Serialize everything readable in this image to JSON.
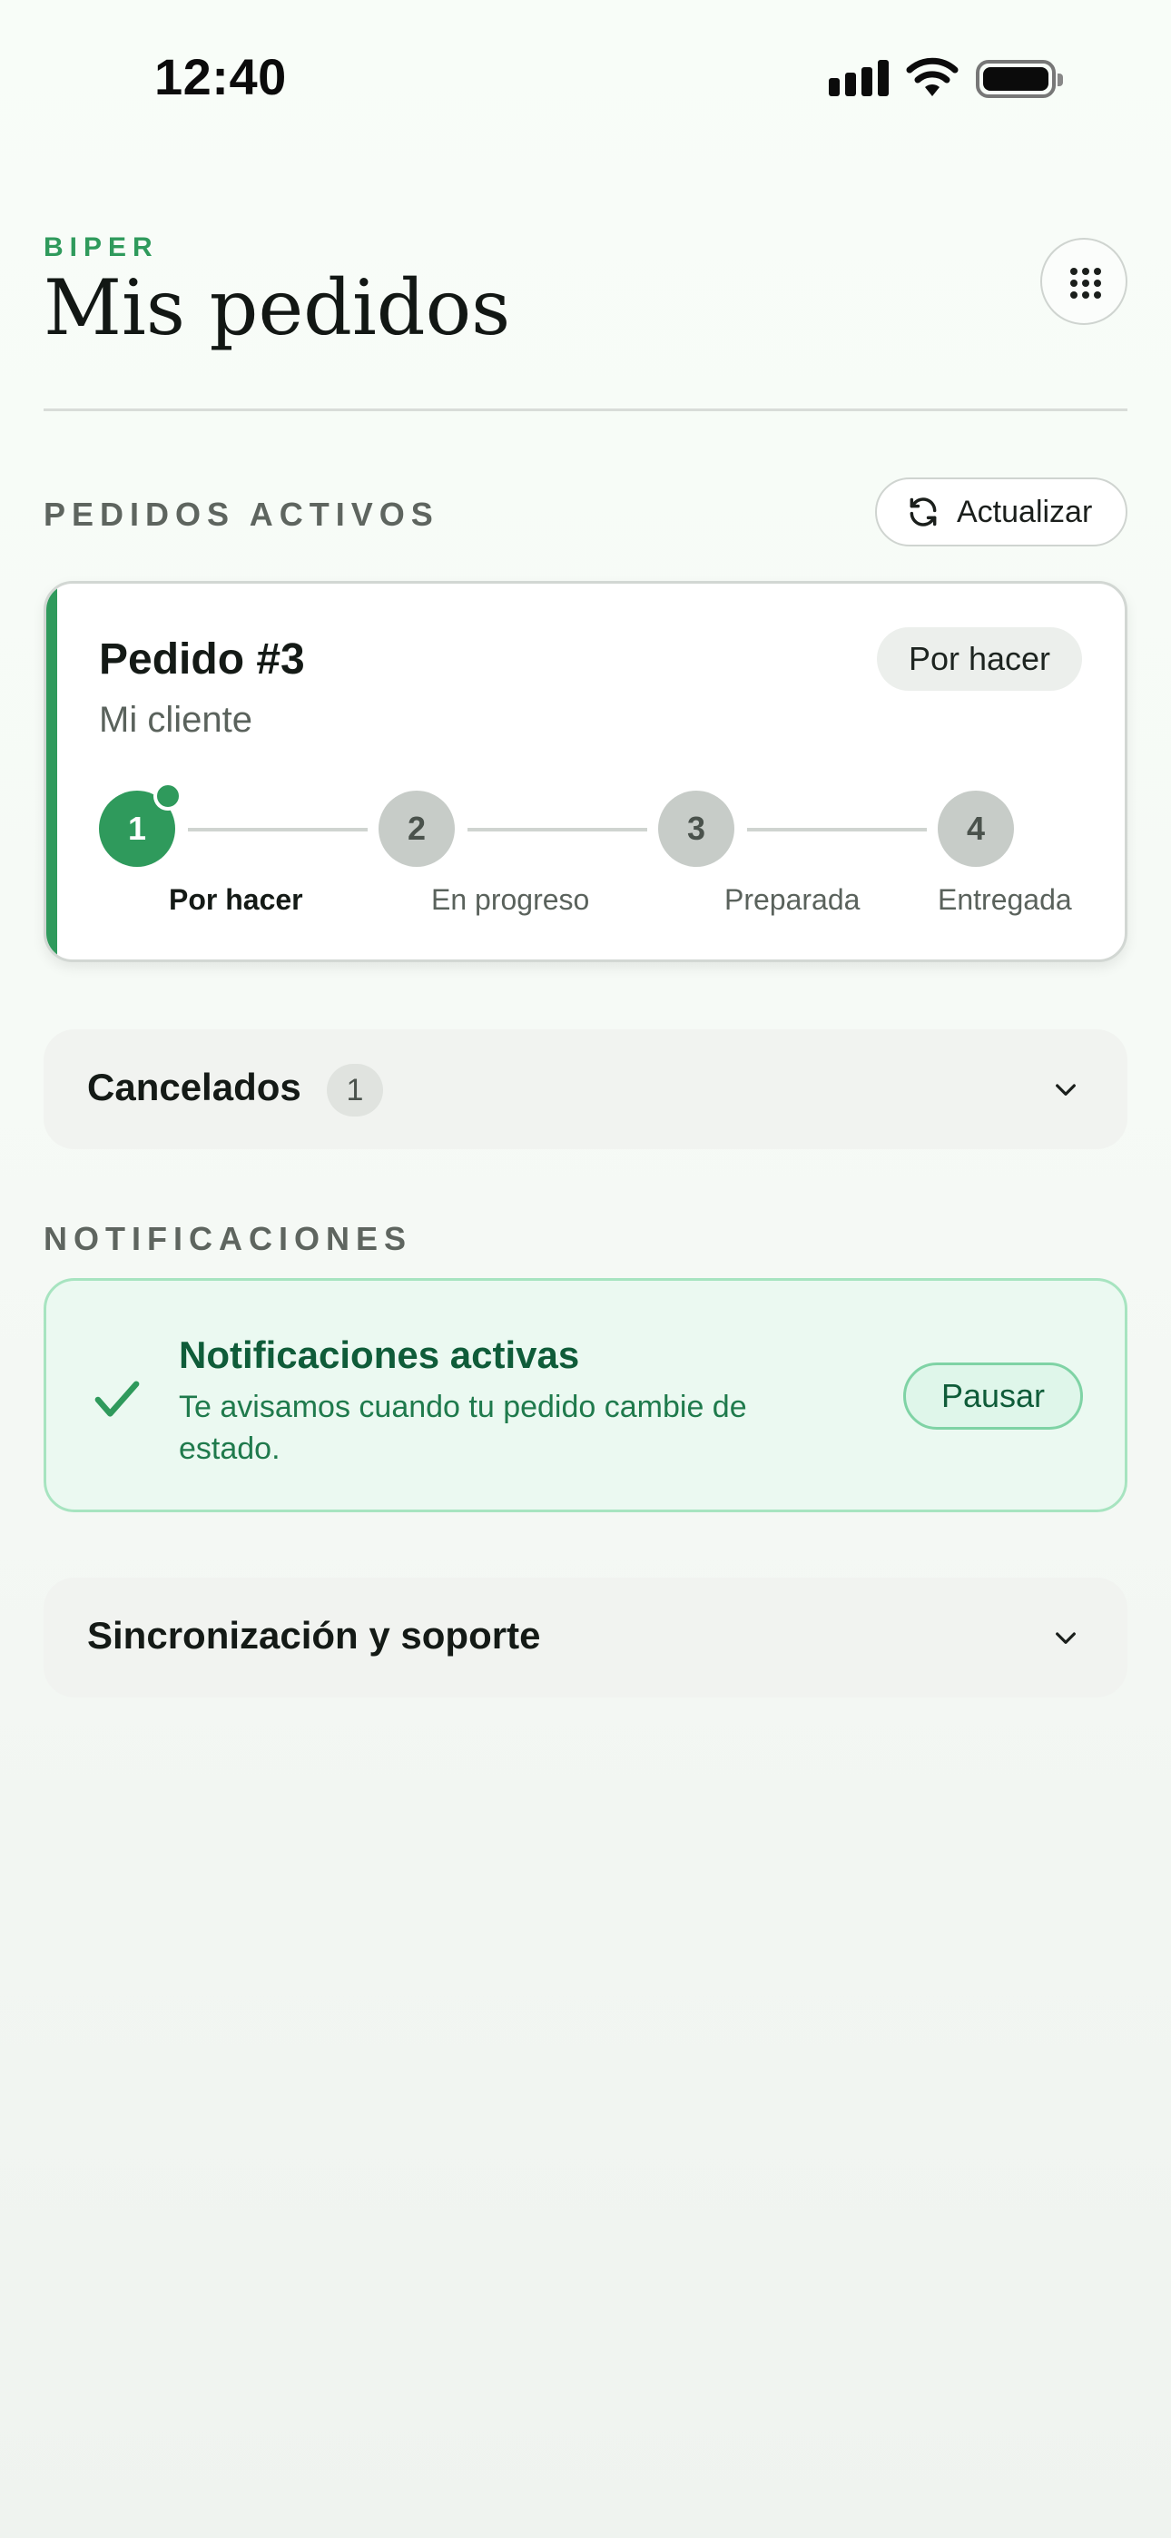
{
  "status_bar": {
    "time": "12:40"
  },
  "header": {
    "brand": "BIPER",
    "title": "Mis pedidos"
  },
  "active_orders": {
    "heading": "PEDIDOS ACTIVOS",
    "refresh_label": "Actualizar",
    "order": {
      "title": "Pedido #3",
      "client": "Mi cliente",
      "status_badge": "Por hacer",
      "current_step": 1,
      "steps": [
        {
          "number": "1",
          "label": "Por hacer"
        },
        {
          "number": "2",
          "label": "En progreso"
        },
        {
          "number": "3",
          "label": "Preparada"
        },
        {
          "number": "4",
          "label": "Entregada"
        }
      ]
    }
  },
  "cancelled": {
    "label": "Cancelados",
    "count": "1"
  },
  "notifications": {
    "heading": "NOTIFICACIONES",
    "title": "Notificaciones activas",
    "text": "Te avisamos cuando tu pedido cambie de estado.",
    "pause_label": "Pausar"
  },
  "sync_support": {
    "label": "Sincronización y soporte"
  },
  "colors": {
    "accent": "#2f9a5c",
    "notification_bg": "#ebf9f1",
    "notification_border": "#a7e4c0"
  },
  "icons": {
    "menu": "grid-dots-icon",
    "refresh": "refresh-icon",
    "chevron": "chevron-down-icon",
    "check": "check-icon"
  }
}
